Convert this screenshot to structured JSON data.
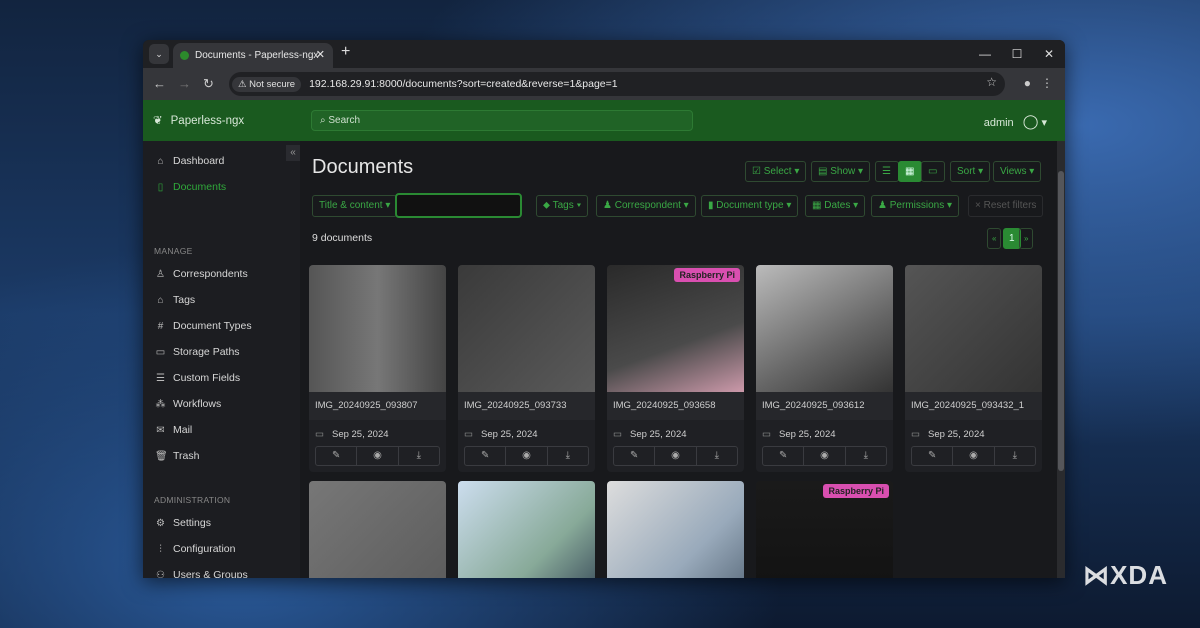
{
  "browser": {
    "tab_title": "Documents - Paperless-ngx",
    "security": "Not secure",
    "url": "192.168.29.91:8000/documents?sort=created&reverse=1&page=1"
  },
  "app": {
    "name": "Paperless-ngx",
    "search_placeholder": "Search",
    "user": "admin"
  },
  "sidebar": {
    "top": [
      {
        "label": "Dashboard",
        "icon": "house-icon"
      },
      {
        "label": "Documents",
        "icon": "document-icon"
      }
    ],
    "manage_heading": "MANAGE",
    "manage": [
      {
        "label": "Correspondents"
      },
      {
        "label": "Tags"
      },
      {
        "label": "Document Types"
      },
      {
        "label": "Storage Paths"
      },
      {
        "label": "Custom Fields"
      },
      {
        "label": "Workflows"
      },
      {
        "label": "Mail"
      },
      {
        "label": "Trash"
      }
    ],
    "admin_heading": "ADMINISTRATION",
    "admin": [
      {
        "label": "Settings"
      },
      {
        "label": "Configuration"
      },
      {
        "label": "Users & Groups"
      }
    ]
  },
  "main": {
    "title": "Documents",
    "toolbar": {
      "select": "Select",
      "show": "Show",
      "sort": "Sort",
      "views": "Views"
    },
    "filters": {
      "title_content": "Title & content",
      "tags": "Tags",
      "correspondent": "Correspondent",
      "document_type": "Document type",
      "dates": "Dates",
      "permissions": "Permissions",
      "reset": "× Reset filters"
    },
    "count": "9 documents",
    "pagination": {
      "prev": "«",
      "page": "1",
      "next": "»"
    },
    "documents": [
      {
        "title": "IMG_20240925_093807",
        "date": "Sep 25, 2024",
        "tag": ""
      },
      {
        "title": "IMG_20240925_093733",
        "date": "Sep 25, 2024",
        "tag": ""
      },
      {
        "title": "IMG_20240925_093658",
        "date": "Sep 25, 2024",
        "tag": "Raspberry Pi"
      },
      {
        "title": "IMG_20240925_093612",
        "date": "Sep 25, 2024",
        "tag": ""
      },
      {
        "title": "IMG_20240925_093432_1",
        "date": "Sep 25, 2024",
        "tag": ""
      },
      {
        "title": "",
        "date": "",
        "tag": ""
      },
      {
        "title": "",
        "date": "",
        "tag": ""
      },
      {
        "title": "",
        "date": "",
        "tag": ""
      },
      {
        "title": "",
        "date": "",
        "tag": "Raspberry Pi"
      }
    ]
  },
  "watermark": "XDA"
}
